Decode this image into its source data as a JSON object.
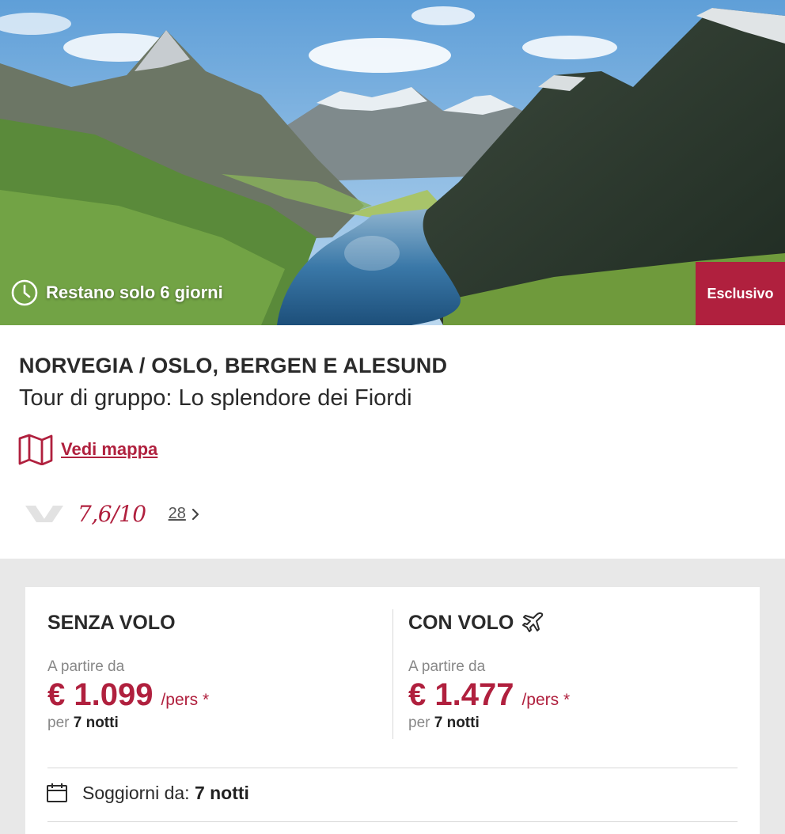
{
  "hero": {
    "countdown": "Restano solo 6 giorni",
    "badge": "Esclusivo"
  },
  "info": {
    "destination": "NORVEGIA / OSLO, BERGEN E ALESUND",
    "subtitle": "Tour di gruppo: Lo splendore dei Fiordi",
    "map_link": "Vedi mappa",
    "rating_score": "7,6/10",
    "review_count": "28"
  },
  "offers": {
    "without_flight": {
      "title": "SENZA VOLO",
      "from_label": "A partire da",
      "price": "€ 1.099",
      "per": "/pers *",
      "per_label": "per",
      "nights": "7 notti"
    },
    "with_flight": {
      "title": "CON VOLO",
      "from_label": "A partire da",
      "price": "€ 1.477",
      "per": "/pers *",
      "per_label": "per",
      "nights": "7 notti"
    }
  },
  "stay": {
    "label": "Soggiorni da:",
    "value": "7 notti"
  },
  "colors": {
    "accent": "#b0203e",
    "section_bg": "#e8e8e8"
  },
  "icons": [
    "clock-icon",
    "map-icon",
    "reviews-logo-icon",
    "chevron-right-icon",
    "airplane-icon",
    "calendar-icon"
  ]
}
